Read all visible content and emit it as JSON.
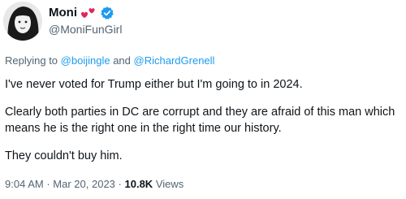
{
  "author": {
    "display_name": "Moni",
    "handle": "@MoniFunGirl",
    "emoji": "hearts-icon",
    "verified_icon": "verified-badge-icon",
    "verified_color": "#1d9bf0"
  },
  "reply": {
    "prefix": "Replying to",
    "mention1": "@boijingle",
    "joiner": "and",
    "mention2": "@RichardGrenell",
    "mention_color": "#1d9bf0"
  },
  "tweet": {
    "paragraphs": [
      "I've never voted for Trump either but I'm going to in 2024.",
      "Clearly both parties in DC are corrupt and they are afraid of this man which means he is the right one in the right time our history.",
      "They couldn't buy him."
    ]
  },
  "meta": {
    "time": "9:04 AM",
    "separator": "·",
    "date": "Mar 20, 2023",
    "views_count": "10.8K",
    "views_label": "Views"
  }
}
